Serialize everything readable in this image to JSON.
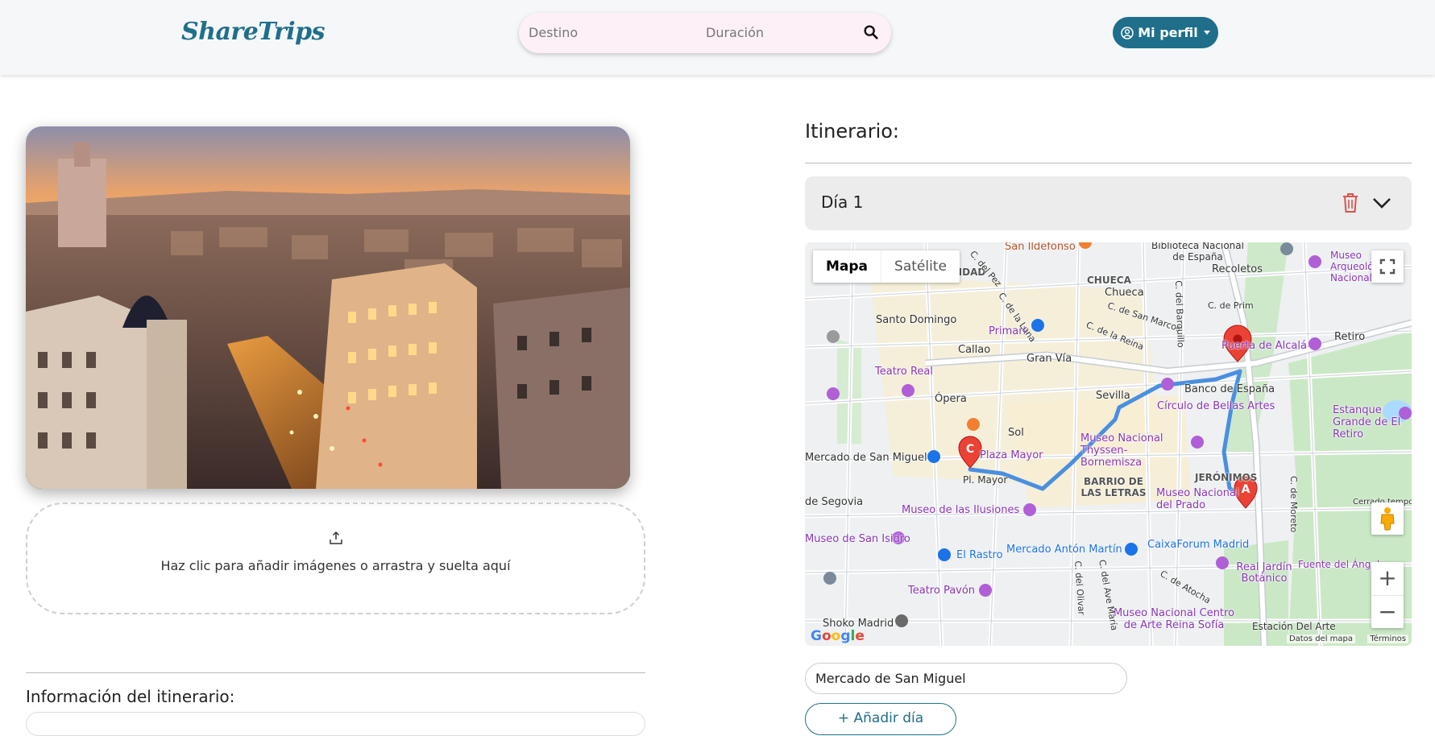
{
  "header": {
    "logo": "ShareTrips",
    "search": {
      "destination_placeholder": "Destino",
      "duration_placeholder": "Duración"
    },
    "profile_label": "Mi perfil"
  },
  "left": {
    "upload_text": "Haz clic para añadir imágenes o arrastra y suelta aquí",
    "info_title": "Información del itinerario:"
  },
  "right": {
    "itinerary_title": "Itinerario:",
    "day_label": "Día 1",
    "map": {
      "tab_map": "Mapa",
      "tab_satellite": "Satélite",
      "labels": [
        "San Ildefonso",
        "Biblioteca Nacional de España",
        "Recoletos",
        "Museo Arqueológico Nacional",
        "CHUECA",
        "Chueca",
        "SIDAD",
        "Santo Domingo",
        "Primark",
        "Callao",
        "Gran Vía",
        "Puerta de Alcalá",
        "Retiro",
        "Banco de España",
        "Teatro Real",
        "Ópera",
        "Sevilla",
        "Círculo de Bellas Artes",
        "Estanque Grande de El Retiro",
        "Sol",
        "Plaza Mayor",
        "Museo Nacional Thyssen-Bornemisza",
        "Mercado de San Miguel",
        "BARRIO DE LAS LETRAS",
        "JERÓNIMOS",
        "Museo Nacional del Prado",
        "Museo de las Ilusiones",
        "Museo de San Isidro",
        "El Rastro",
        "Mercado Antón Martín",
        "CaixaForum Madrid",
        "Real Jardín Botánico",
        "Teatro Pavón",
        "Shoko Madrid",
        "Museo Nacional Centro de Arte Reina Sofía",
        "Estación Del Arte",
        "Fuente del Ángel",
        "Pl. Mayor",
        "C. del Pez",
        "C. de la Luna",
        "C. de San Marcos",
        "C. de la Reina",
        "C. del Barquillo",
        "C. de Prim",
        "C. de Moreto",
        "C. del Olivar",
        "C. del Ave María",
        "C. de Atocha",
        "de Segovia",
        "Cerrado temporalmente"
      ],
      "markers": [
        "A",
        "C"
      ],
      "google": "Google",
      "map_data": "Datos del mapa",
      "terms": "Términos"
    },
    "place_input_value": "Mercado de San Miguel",
    "add_day_label": "+ Añadir día"
  },
  "colors": {
    "brand": "#1f6f8b",
    "trash": "#d9534f",
    "route": "#4a8fe0",
    "marker": "#ea4335"
  }
}
